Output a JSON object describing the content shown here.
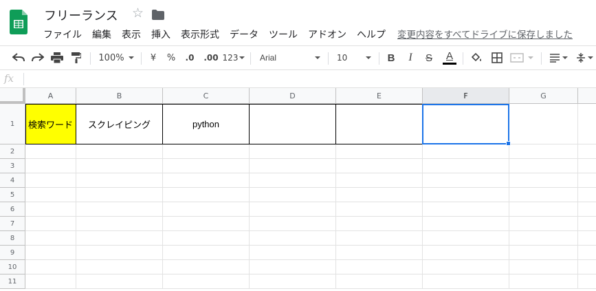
{
  "document": {
    "title": "フリーランス",
    "save_status": "変更内容をすべてドライブに保存しました"
  },
  "menu": [
    "ファイル",
    "編集",
    "表示",
    "挿入",
    "表示形式",
    "データ",
    "ツール",
    "アドオン",
    "ヘルプ"
  ],
  "toolbar": {
    "zoom": "100%",
    "currency": "¥",
    "percent": "%",
    "decimal_decrease": ".0",
    "decimal_increase": ".00",
    "number_format": "123",
    "font": "Arial",
    "font_size": "10",
    "bold": "B",
    "italic": "I",
    "strikethrough": "S",
    "text_color_letter": "A"
  },
  "formula_bar": {
    "fx_label": "fx"
  },
  "grid": {
    "columns": [
      "A",
      "B",
      "C",
      "D",
      "E",
      "F",
      "G"
    ],
    "selected_column": "F",
    "rows": [
      "1",
      "2",
      "3",
      "4",
      "5",
      "6",
      "7",
      "8",
      "9",
      "10",
      "11"
    ],
    "cells": {
      "A1": "検索ワード",
      "B1": "スクレイピング",
      "C1": "python"
    },
    "colors": {
      "A1_fill": "#ffff00",
      "selection": "#1a73e8",
      "sheets_green": "#0f9d58"
    }
  }
}
